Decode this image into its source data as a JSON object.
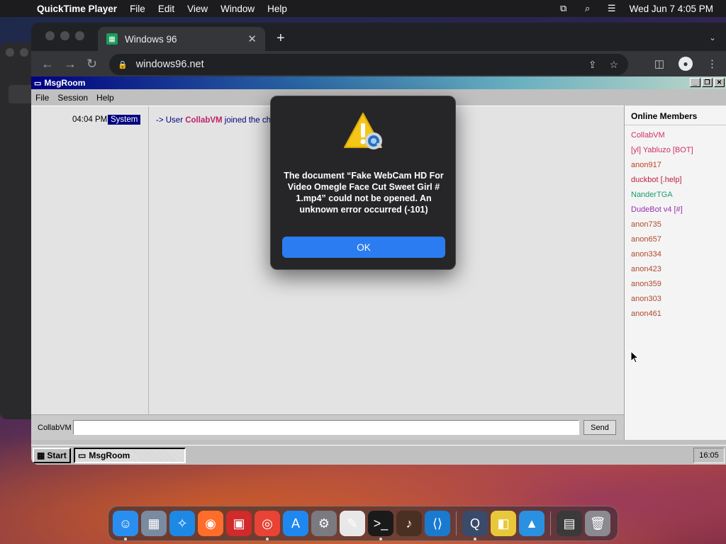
{
  "menubar": {
    "app_name": "QuickTime Player",
    "items": [
      "File",
      "Edit",
      "View",
      "Window",
      "Help"
    ],
    "datetime": "Wed Jun 7  4:05 PM"
  },
  "browser": {
    "tab_title": "Windows 96",
    "url": "windows96.net"
  },
  "msgroom": {
    "window_title": "MsgRoom",
    "menu": [
      "File",
      "Session",
      "Help"
    ],
    "messages": [
      {
        "time": "04:04 PM",
        "sender": "System",
        "prefix": "-> User ",
        "user": "CollabVM",
        "text": " joined the cha"
      }
    ],
    "members_title": "Online Members",
    "members": [
      {
        "name": "CollabVM",
        "color": "#d0306a"
      },
      {
        "name": "[yl] Yabluzo [BOT]",
        "color": "#d0306a"
      },
      {
        "name": "anon917",
        "color": "#c04020"
      },
      {
        "name": "duckbot [.help]",
        "color": "#c02040"
      },
      {
        "name": "NanderTGA",
        "color": "#1a9e6a"
      },
      {
        "name": "DudeBot v4 [#]",
        "color": "#9a30b0"
      },
      {
        "name": "anon735",
        "color": "#b04a2a"
      },
      {
        "name": "anon657",
        "color": "#b04a2a"
      },
      {
        "name": "anon334",
        "color": "#b04a2a"
      },
      {
        "name": "anon423",
        "color": "#b04a2a"
      },
      {
        "name": "anon359",
        "color": "#b04a2a"
      },
      {
        "name": "anon303",
        "color": "#b04a2a"
      },
      {
        "name": "anon461",
        "color": "#b04a2a"
      }
    ],
    "chat_name": "CollabVM",
    "chat_input_value": "",
    "send_label": "Send"
  },
  "w96_taskbar": {
    "start_label": "Start",
    "task_label": "MsgRoom",
    "clock": "16:05"
  },
  "alert": {
    "message": "The document “Fake WebCam HD For Video Omegle   Face Cut Sweet Girl # 1.mp4” could not be opened. An unknown error occurred (-101)",
    "ok_label": "OK"
  },
  "dock": {
    "items": [
      {
        "name": "finder-icon",
        "color": "#2a8ef0",
        "glyph": "☺",
        "running": true
      },
      {
        "name": "launchpad-icon",
        "color": "#7a8aa0",
        "glyph": "▦",
        "running": false
      },
      {
        "name": "safari-icon",
        "color": "#1e88e5",
        "glyph": "✧",
        "running": false
      },
      {
        "name": "firefox-icon",
        "color": "#ff6d2a",
        "glyph": "◉",
        "running": false
      },
      {
        "name": "photo-booth-icon",
        "color": "#d02a2a",
        "glyph": "▣",
        "running": false
      },
      {
        "name": "chrome-icon",
        "color": "#e84335",
        "glyph": "◎",
        "running": true
      },
      {
        "name": "app-store-icon",
        "color": "#1e88f0",
        "glyph": "A",
        "running": false
      },
      {
        "name": "system-settings-icon",
        "color": "#7a7a80",
        "glyph": "⚙",
        "running": false
      },
      {
        "name": "textedit-icon",
        "color": "#e8e8e8",
        "glyph": "✎",
        "running": false
      },
      {
        "name": "terminal-icon",
        "color": "#1a1a1a",
        "glyph": ">_",
        "running": true
      },
      {
        "name": "garageband-icon",
        "color": "#4a3020",
        "glyph": "♪",
        "running": false
      },
      {
        "name": "vscode-icon",
        "color": "#1a7ad0",
        "glyph": "⟨⟩",
        "running": false
      },
      {
        "name": "quicktime-icon",
        "color": "#3a4a6a",
        "glyph": "Q",
        "running": true
      },
      {
        "name": "stickies-icon",
        "color": "#e8c83a",
        "glyph": "◧",
        "running": false
      },
      {
        "name": "keynote-icon",
        "color": "#2a90e0",
        "glyph": "▲",
        "running": false
      },
      {
        "name": "recent-app-icon",
        "color": "#3a3a3a",
        "glyph": "▤",
        "running": false
      },
      {
        "name": "trash-icon",
        "color": "#8a8a90",
        "glyph": "🗑",
        "running": false
      }
    ]
  }
}
